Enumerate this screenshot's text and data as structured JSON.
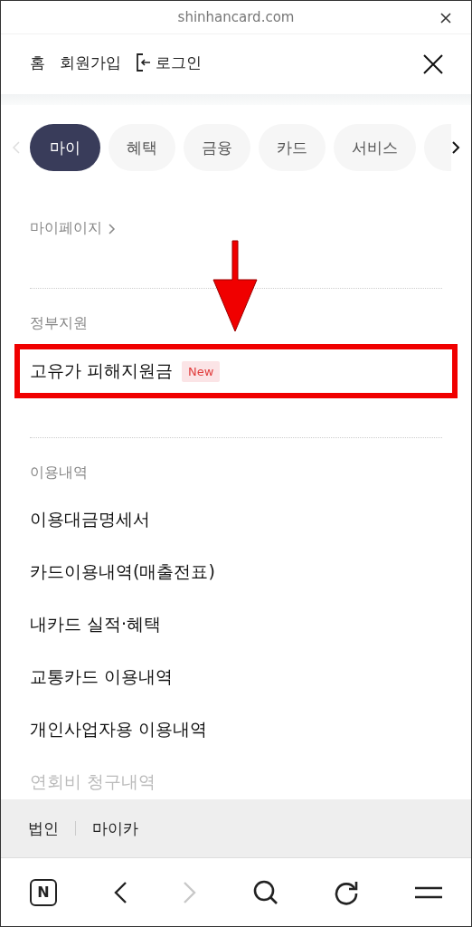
{
  "browser_bar": {
    "url": "shinhancard.com"
  },
  "header": {
    "links": [
      {
        "label": "홈",
        "kind": "text"
      },
      {
        "label": "회원가입",
        "kind": "text"
      },
      {
        "label": "로그인",
        "kind": "login"
      }
    ]
  },
  "tabs": [
    {
      "label": "마이",
      "selected": true
    },
    {
      "label": "혜택",
      "selected": false
    },
    {
      "label": "금융",
      "selected": false
    },
    {
      "label": "카드",
      "selected": false
    },
    {
      "label": "서비스",
      "selected": false
    }
  ],
  "mypage_link": "마이페이지",
  "sections": [
    {
      "title": "정부지원",
      "items": [
        {
          "label": "고유가 피해지원금",
          "badge": "New",
          "highlighted": true
        }
      ]
    },
    {
      "title": "이용내역",
      "items": [
        {
          "label": "이용대금명세서",
          "highlighted": false
        },
        {
          "label": "카드이용내역(매출전표)",
          "highlighted": false
        },
        {
          "label": "내카드 실적·혜택",
          "highlighted": false
        },
        {
          "label": "교통카드 이용내역",
          "highlighted": false
        },
        {
          "label": "개인사업자용 이용내역",
          "highlighted": false
        },
        {
          "label": "연회비 청구내역",
          "highlighted": false,
          "faded": true
        }
      ]
    }
  ],
  "footer_links": [
    "법인",
    "마이카"
  ],
  "toolbar": {
    "logo_letter": "N",
    "forward_disabled": true
  }
}
